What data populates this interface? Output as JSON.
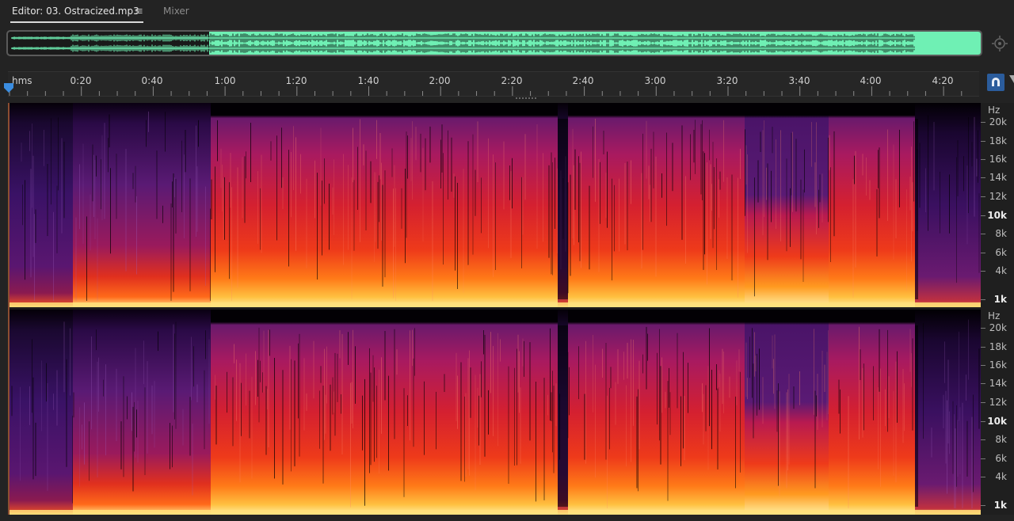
{
  "tabs": {
    "editor_label": "Editor: 03. Ostracized.mp3",
    "menu_glyph": "≡",
    "mixer_label": "Mixer"
  },
  "ruler": {
    "unit": "hms",
    "labels": [
      "0:20",
      "0:40",
      "1:00",
      "1:20",
      "1:40",
      "2:00",
      "2:20",
      "2:40",
      "3:00",
      "3:20",
      "3:40",
      "4:00",
      "4:20"
    ]
  },
  "hz_scale": {
    "unit": "Hz",
    "labels": [
      "20k",
      "18k",
      "16k",
      "14k",
      "12k",
      "10k",
      "8k",
      "6k",
      "4k",
      "1k"
    ],
    "major": [
      "10k",
      "1k"
    ]
  },
  "colors": {
    "waveform": "#6ff0b4",
    "accent": "#2b5c9c",
    "spectrum_low": "#2a0a3a",
    "spectrum_mid": "#c81c2e",
    "spectrum_high": "#ffe58a"
  },
  "icons": {
    "zoom": "zoom-to-selection-icon",
    "snap": "snap-magnet-icon",
    "playhead": "playhead-marker-icon"
  }
}
